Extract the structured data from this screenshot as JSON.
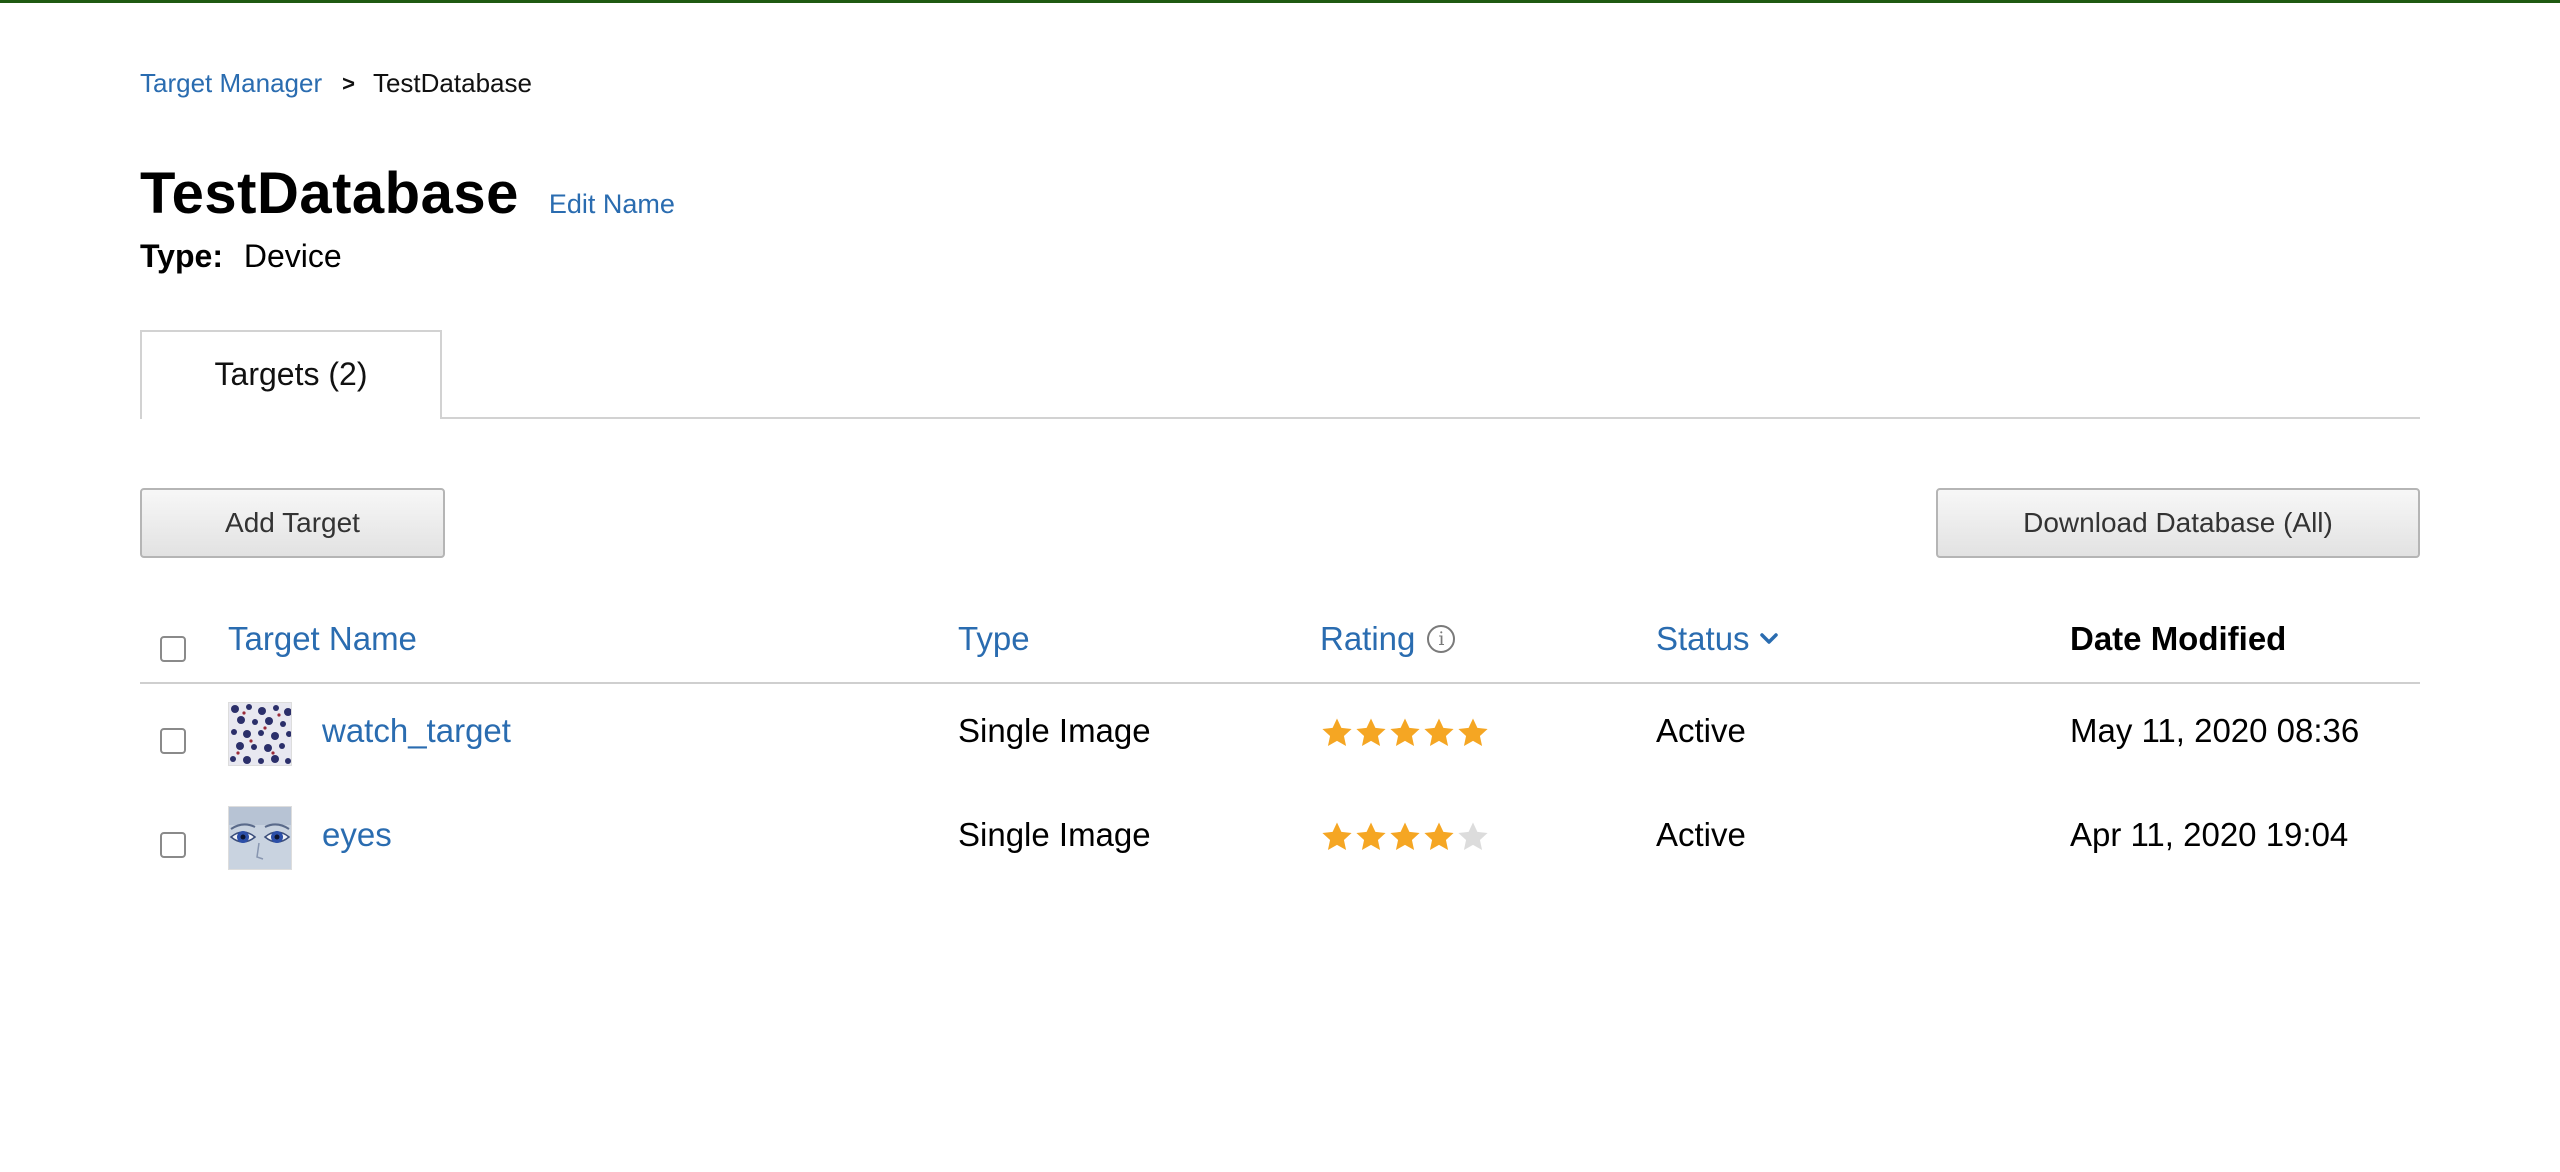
{
  "breadcrumb": {
    "root": "Target Manager",
    "separator": ">",
    "current": "TestDatabase"
  },
  "page": {
    "title": "TestDatabase",
    "edit_label": "Edit Name",
    "type_label": "Type:",
    "type_value": "Device"
  },
  "tabs": [
    {
      "label": "Targets (2)"
    }
  ],
  "actions": {
    "add_label": "Add Target",
    "download_label": "Download Database (All)"
  },
  "table": {
    "columns": {
      "name": "Target Name",
      "type": "Type",
      "rating": "Rating",
      "status": "Status",
      "date": "Date Modified"
    },
    "rows": [
      {
        "name": "watch_target",
        "type": "Single Image",
        "rating": 5,
        "rating_max": 5,
        "status": "Active",
        "date": "May 11, 2020 08:36",
        "thumb": "pattern-thumbnail"
      },
      {
        "name": "eyes",
        "type": "Single Image",
        "rating": 4,
        "rating_max": 5,
        "status": "Active",
        "date": "Apr 11, 2020 19:04",
        "thumb": "eyes-thumbnail"
      }
    ]
  },
  "colors": {
    "link": "#2a6cb0",
    "star_on": "#f5a623",
    "star_off": "#dcdcdc",
    "top_bar": "#1f5a12"
  },
  "icons": {
    "info": "info-icon",
    "sort": "chevron-down-icon",
    "star": "star-icon"
  }
}
